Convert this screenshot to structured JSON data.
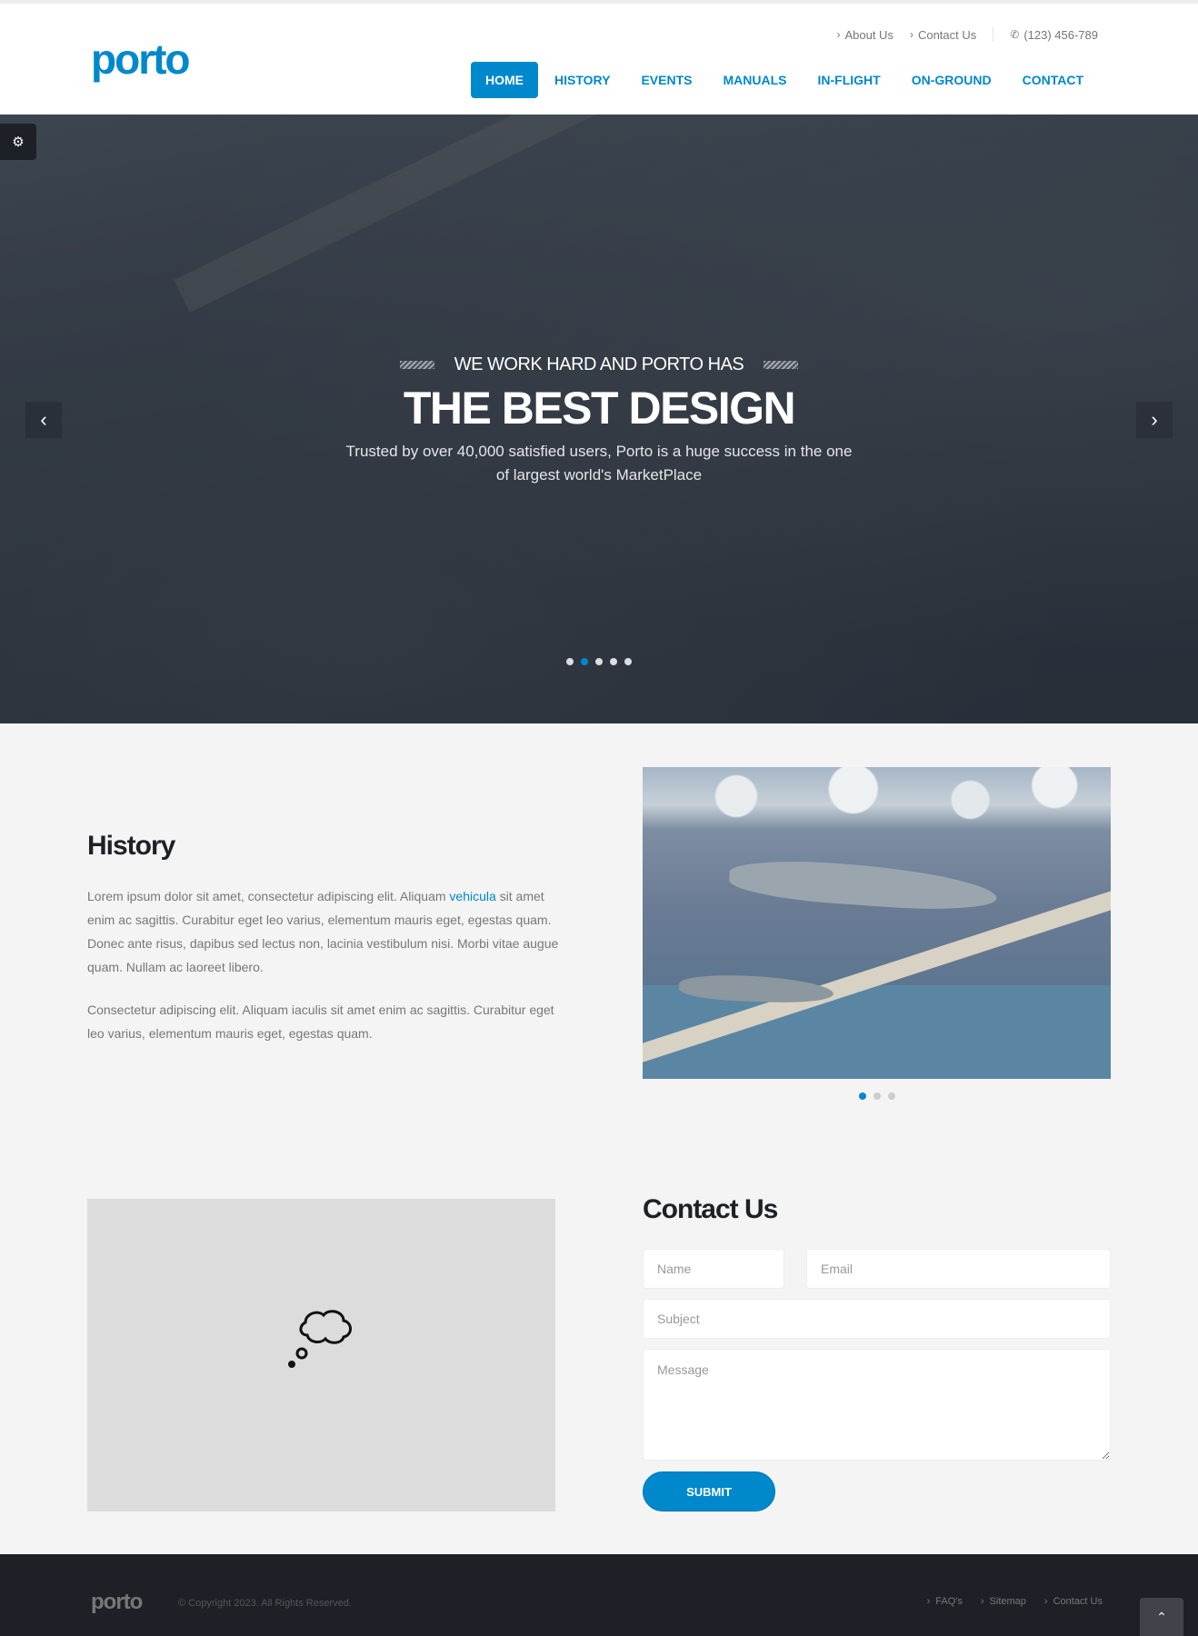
{
  "header": {
    "logo_text": "porto",
    "top_links": [
      {
        "label": "About Us"
      },
      {
        "label": "Contact Us"
      }
    ],
    "phone": "(123) 456-789",
    "nav": [
      {
        "label": "HOME",
        "active": true
      },
      {
        "label": "HISTORY"
      },
      {
        "label": "EVENTS"
      },
      {
        "label": "MANUALS"
      },
      {
        "label": "IN-FLIGHT"
      },
      {
        "label": "ON-GROUND"
      },
      {
        "label": "CONTACT"
      }
    ]
  },
  "hero": {
    "subtitle": "WE WORK HARD AND PORTO HAS",
    "title": "THE BEST DESIGN",
    "text": "Trusted by over 40,000 satisfied users, Porto is a huge success in the one of largest world's MarketPlace",
    "slides": 5,
    "active_slide": 2,
    "icons": {
      "prev": "chevron-left-icon",
      "next": "chevron-right-icon",
      "settings": "gears-icon"
    }
  },
  "history": {
    "title": "History",
    "p1_before": "Lorem ipsum dolor sit amet, consectetur adipiscing elit. Aliquam ",
    "p1_link": "vehicula",
    "p1_after": " sit amet enim ac sagittis. Curabitur eget leo varius, elementum mauris eget, egestas quam. Donec ante risus, dapibus sed lectus non, lacinia vestibulum nisi. Morbi vitae augue quam. Nullam ac laoreet libero.",
    "p2": "Consectetur adipiscing elit. Aliquam iaculis sit amet enim ac sagittis. Curabitur eget leo varius, elementum mauris eget, egestas quam.",
    "carousel": {
      "slides": 3,
      "active_slide": 1
    }
  },
  "contact": {
    "title": "Contact Us",
    "name_placeholder": "Name",
    "email_placeholder": "Email",
    "subject_placeholder": "Subject",
    "message_placeholder": "Message",
    "submit_label": "SUBMIT"
  },
  "footer": {
    "logo_text": "porto",
    "copyright": "© Copyright 2023. All Rights Reserved.",
    "links": [
      {
        "label": "FAQ's"
      },
      {
        "label": "Sitemap"
      },
      {
        "label": "Contact Us"
      }
    ]
  },
  "colors": {
    "accent": "#0088cc",
    "dark": "#1d2127",
    "background": "#f4f4f4"
  }
}
